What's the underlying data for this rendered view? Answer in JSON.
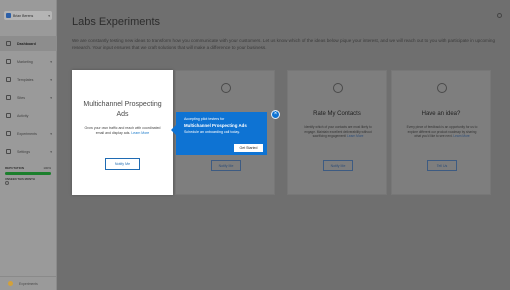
{
  "sidebar": {
    "brand": {
      "name": "Brian Berens"
    },
    "items": [
      {
        "label": "Dashboard",
        "active": true,
        "has_caret": false
      },
      {
        "label": "Marketing",
        "active": false,
        "has_caret": true
      },
      {
        "label": "Templates",
        "active": false,
        "has_caret": true
      },
      {
        "label": "Sites",
        "active": false,
        "has_caret": true
      },
      {
        "label": "Activity",
        "active": false,
        "has_caret": false
      },
      {
        "label": "Experiments",
        "active": false,
        "has_caret": true
      },
      {
        "label": "Settings",
        "active": false,
        "has_caret": true
      }
    ],
    "reputation": {
      "label": "REPUTATION",
      "value": "100%",
      "fill_fraction": 1.0
    },
    "check_label": "UNSEEN THIS MONTH",
    "bottom_label": "Experiments"
  },
  "main": {
    "title": "Labs Experiments",
    "description": "We are constantly testing new ideas to transform how you communicate with your customers. Let us know which of the ideas below pique your interest, and we will reach out to you with participate in upcoming research. Your input ensures that we craft solutions that will make a difference to your business.",
    "cards": [
      {
        "title": "Multichannel Prospecting Ads",
        "desc": "Grow your own traffic and reach with coordinated email and display ads.",
        "link": "Learn More",
        "button": "Notify Me"
      },
      {
        "title": "Rate My Contacts",
        "desc": "Identify which of your contacts are most likely to engage. Maintain excellent deliverability without sacrificing engagement!",
        "link": "Learn More",
        "button": "Notify Me"
      },
      {
        "title": "Have an idea?",
        "desc": "Every piece of feedback is an opportunity for us to explore different our product roadmap by sharing what you'd like to see next.",
        "link": "Learn More",
        "button": "Tell Us"
      }
    ],
    "hidden_card_button": "Notify Me"
  },
  "tooltip": {
    "line1": "Accepting pilot testers for",
    "line2": "Multichannel Prospecting Ads",
    "line3": "Schedule an onboarding call today.",
    "button": "Get Started",
    "close_glyph": "×"
  },
  "colors": {
    "accent": "#0e73d3",
    "reputation_bar": "#1b7f2c",
    "overlay": "#6f6f6f"
  }
}
